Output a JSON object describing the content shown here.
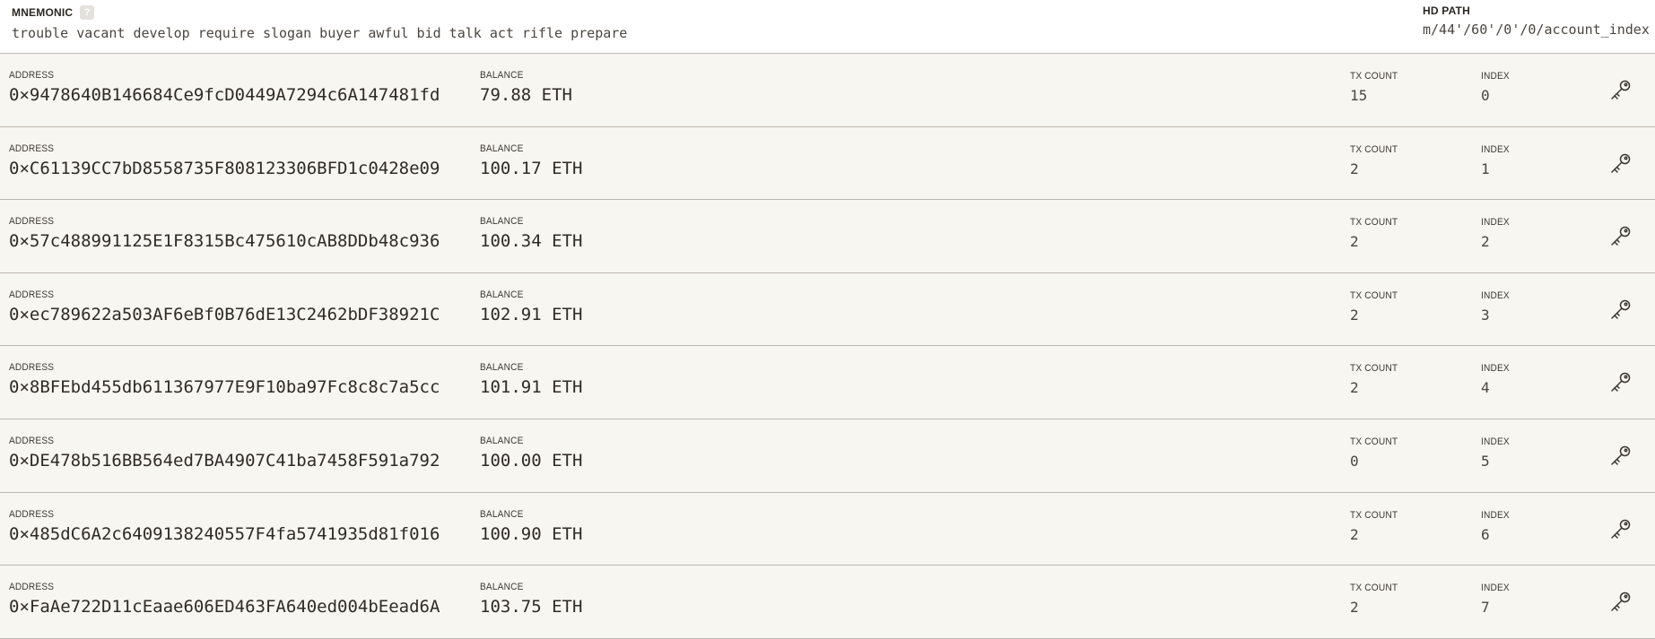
{
  "header": {
    "mnemonic_label": "MNEMONIC",
    "help_glyph": "?",
    "mnemonic": "trouble vacant develop require slogan buyer awful bid talk act rifle prepare",
    "hd_path_label": "HD PATH",
    "hd_path": "m/44'/60'/0'/0/account_index"
  },
  "labels": {
    "address": "ADDRESS",
    "balance": "BALANCE",
    "tx_count": "TX COUNT",
    "index": "INDEX"
  },
  "icons": {
    "row_action": "key-icon",
    "help": "question-mark-icon"
  },
  "accounts": [
    {
      "address": "0×9478640B146684Ce9fcD0449A7294c6A147481fd",
      "balance": "79.88 ETH",
      "tx_count": "15",
      "index": "0"
    },
    {
      "address": "0×C61139CC7bD8558735F808123306BFD1c0428e09",
      "balance": "100.17 ETH",
      "tx_count": "2",
      "index": "1"
    },
    {
      "address": "0×57c488991125E1F8315Bc475610cAB8DDb48c936",
      "balance": "100.34 ETH",
      "tx_count": "2",
      "index": "2"
    },
    {
      "address": "0×ec789622a503AF6eBf0B76dE13C2462bDF38921C",
      "balance": "102.91 ETH",
      "tx_count": "2",
      "index": "3"
    },
    {
      "address": "0×8BFEbd455db611367977E9F10ba97Fc8c8c7a5cc",
      "balance": "101.91 ETH",
      "tx_count": "2",
      "index": "4"
    },
    {
      "address": "0×DE478b516BB564ed7BA4907C41ba7458F591a792",
      "balance": "100.00 ETH",
      "tx_count": "0",
      "index": "5"
    },
    {
      "address": "0×485dC6A2c6409138240557F4fa5741935d81f016",
      "balance": "100.90 ETH",
      "tx_count": "2",
      "index": "6"
    },
    {
      "address": "0×FaAe722D11cEaae606ED463FA640ed004bEead6A",
      "balance": "103.75 ETH",
      "tx_count": "2",
      "index": "7"
    }
  ]
}
